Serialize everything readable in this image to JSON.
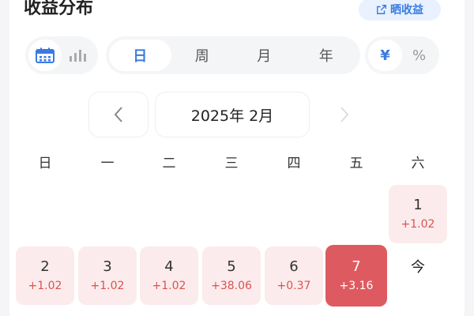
{
  "header": {
    "title": "收益分布",
    "share_label": "晒收益"
  },
  "view_toggle": [
    {
      "icon": "calendar-icon",
      "active": true
    },
    {
      "icon": "bar-chart-icon",
      "active": false
    }
  ],
  "period_tabs": [
    {
      "label": "日",
      "active": true
    },
    {
      "label": "周",
      "active": false
    },
    {
      "label": "月",
      "active": false
    },
    {
      "label": "年",
      "active": false
    }
  ],
  "unit_toggle": [
    {
      "label": "¥",
      "active": true
    },
    {
      "label": "%",
      "active": false
    }
  ],
  "month_nav": {
    "label": "2025年 2月"
  },
  "weekdays": [
    "日",
    "一",
    "二",
    "三",
    "四",
    "五",
    "六"
  ],
  "days": [
    {
      "day": "1",
      "value": "+1.02",
      "highlight": false
    },
    {
      "day": "2",
      "value": "+1.02",
      "highlight": false
    },
    {
      "day": "3",
      "value": "+1.02",
      "highlight": false
    },
    {
      "day": "4",
      "value": "+1.02",
      "highlight": false
    },
    {
      "day": "5",
      "value": "+38.06",
      "highlight": false
    },
    {
      "day": "6",
      "value": "+0.37",
      "highlight": false
    },
    {
      "day": "7",
      "value": "+3.16",
      "highlight": true
    }
  ],
  "today_label": "今",
  "colors": {
    "accent": "#3a7be0",
    "gain": "#d9534f",
    "gain_bg": "#fcebec",
    "highlight": "#dd5b60"
  }
}
